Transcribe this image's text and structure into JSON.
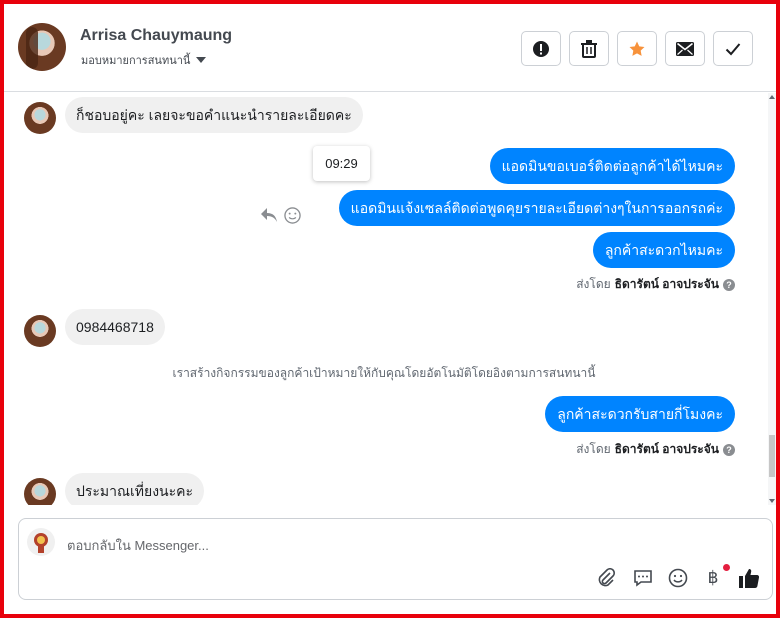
{
  "header": {
    "contact_name": "Arrisa Chauymaung",
    "assignment_label": "มอบหมายการสนทนานี้",
    "actions": [
      {
        "name": "report",
        "icon": "exclamation-icon"
      },
      {
        "name": "delete",
        "icon": "trash-icon"
      },
      {
        "name": "star",
        "icon": "star-icon",
        "color": "#f7923b"
      },
      {
        "name": "mail",
        "icon": "envelope-icon"
      },
      {
        "name": "done",
        "icon": "check-icon"
      }
    ]
  },
  "messages": {
    "incoming_1": "ก็ชอบอยู่คะ เลยจะขอคำแนะนำรายละเอียดคะ",
    "time_tooltip": "09:29",
    "outgoing_1": "แอดมินขอเบอร์ติดต่อลูกค้าได้ไหมคะ",
    "outgoing_2": "แอดมินแจ้งเซลล์ติดต่อพูดคุยรายละเอียดต่างๆในการออกรถค่ะ",
    "outgoing_3": "ลูกค้าสะดวกไหมคะ",
    "sent_by_label_1": "ส่งโดย",
    "sent_by_name_1": "ธิดารัตน์ อาจประจัน",
    "incoming_2": "0984468718",
    "system_note": "เราสร้างกิจกรรมของลูกค้าเป้าหมายให้กับคุณโดยอัตโนมัติโดยอิงตามการสนทนานี้",
    "outgoing_4": "ลูกค้าสะดวกรับสายกี่โมงคะ",
    "sent_by_label_2": "ส่งโดย",
    "sent_by_name_2": "ธิดารัตน์ อาจประจัน",
    "incoming_3": "ประมาณเที่ยงนะคะ"
  },
  "composer": {
    "placeholder": "ตอบกลับใน Messenger...",
    "tools": [
      "paperclip-icon",
      "chat-icon",
      "emoji-icon",
      "baht-icon",
      "thumbs-up-icon"
    ]
  },
  "colors": {
    "brand_blue": "#0084ff",
    "frame_red": "#e8000b",
    "star": "#f7923b"
  }
}
